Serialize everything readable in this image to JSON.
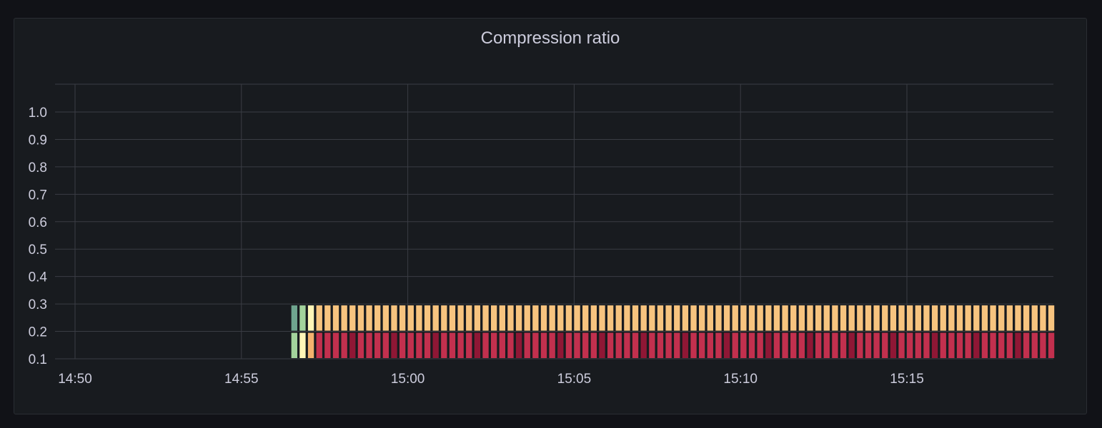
{
  "panel": {
    "title": "Compression ratio"
  },
  "colors": {
    "background": "#111217",
    "panel": "#181b1f",
    "grid": "#3a3d44",
    "text": "#ccccdc",
    "ramp_low_dark": "#6fa58f",
    "ramp_low_light": "#a3d39c",
    "ramp_pale": "#fff6b8",
    "ramp_orange": "#f3b26e",
    "ramp_peach": "#f7c47f",
    "ramp_red": "#c2304e",
    "ramp_darkred": "#8f1735"
  },
  "chart_data": {
    "type": "heatmap",
    "title": "Compression ratio",
    "x_ticks": [
      "14:50",
      "14:55",
      "15:00",
      "15:05",
      "15:10",
      "15:15"
    ],
    "y_ticks": [
      "0.1",
      "0.2",
      "0.3",
      "0.4",
      "0.5",
      "0.6",
      "0.7",
      "0.8",
      "0.9",
      "1.0"
    ],
    "y_buckets": [
      {
        "from": 0.1,
        "to": 0.2
      },
      {
        "from": 0.2,
        "to": 0.3
      }
    ],
    "time_range": [
      "14:49:24",
      "15:19:30"
    ],
    "data_start": "14:56:30",
    "interval_seconds": 15,
    "xlim_minutes": [
      -0.6,
      29.5
    ],
    "ylim": [
      0.1,
      1.1
    ],
    "grid": true,
    "legend": "none",
    "first_columns": [
      {
        "lower": "ramp_low_light",
        "upper": "ramp_low_dark"
      },
      {
        "lower": "ramp_pale",
        "upper": "ramp_low_light"
      },
      {
        "lower": "ramp_orange",
        "upper": "ramp_pale"
      }
    ],
    "steady_state": {
      "lower": "ramp_red",
      "upper": "ramp_peach"
    }
  }
}
